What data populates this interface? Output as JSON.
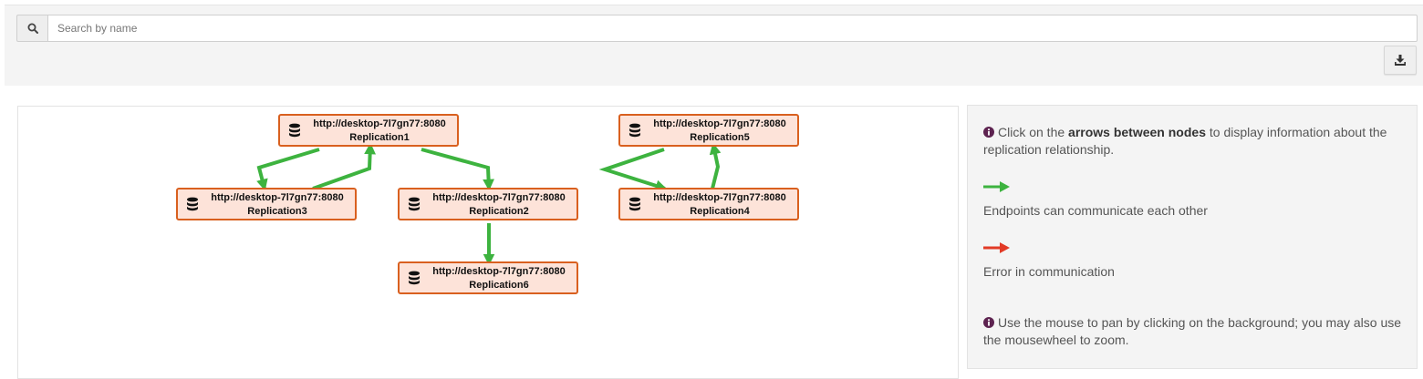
{
  "search": {
    "placeholder": "Search by name",
    "icon": "search-icon"
  },
  "toolbar": {
    "export_icon": "download-icon"
  },
  "graph": {
    "nodes": [
      {
        "id": "n1",
        "url": "http://desktop-7l7gn77:8080",
        "name": "Replication1"
      },
      {
        "id": "n5",
        "url": "http://desktop-7l7gn77:8080",
        "name": "Replication5"
      },
      {
        "id": "n3",
        "url": "http://desktop-7l7gn77:8080",
        "name": "Replication3"
      },
      {
        "id": "n2",
        "url": "http://desktop-7l7gn77:8080",
        "name": "Replication2"
      },
      {
        "id": "n4",
        "url": "http://desktop-7l7gn77:8080",
        "name": "Replication4"
      },
      {
        "id": "n6",
        "url": "http://desktop-7l7gn77:8080",
        "name": "Replication6"
      }
    ],
    "edges": [
      {
        "from": "Replication1",
        "to": "Replication3",
        "status": "ok"
      },
      {
        "from": "Replication3",
        "to": "Replication1",
        "status": "ok"
      },
      {
        "from": "Replication1",
        "to": "Replication2",
        "status": "ok"
      },
      {
        "from": "Replication2",
        "to": "Replication6",
        "status": "ok"
      },
      {
        "from": "Replication4",
        "to": "Replication5",
        "status": "ok"
      },
      {
        "from": "Replication5",
        "to": "Replication4",
        "status": "ok"
      }
    ]
  },
  "legend": {
    "intro_prefix": "Click on the ",
    "intro_bold": "arrows between nodes",
    "intro_suffix": " to display information about the replication relationship.",
    "ok_label": "Endpoints can communicate each other",
    "error_label": "Error in communication",
    "pan_text": "Use the mouse to pan by clicking on the background; you may also use the mousewheel to zoom."
  },
  "colors": {
    "ok": "#3db33f",
    "error": "#e23a26",
    "info": "#5d2350",
    "node_fill": "#fde3d9",
    "node_border": "#d9601f"
  }
}
